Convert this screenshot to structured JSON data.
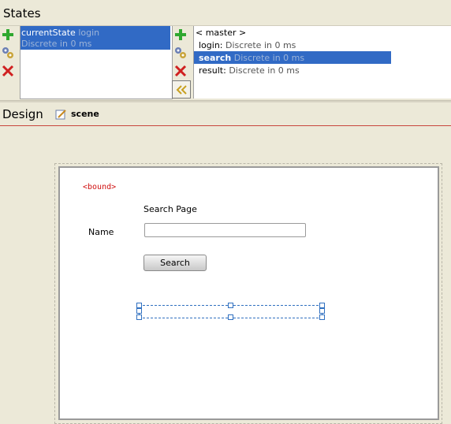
{
  "states_panel": {
    "title": "States",
    "left_list": {
      "selected_name": "currentState",
      "selected_value": "login",
      "selected_detail": "Discrete in 0 ms"
    },
    "right_list": {
      "master_label": "< master >",
      "items": [
        {
          "name": "login:",
          "detail": "Discrete in 0 ms"
        },
        {
          "name": "search",
          "detail": "Discrete in 0 ms",
          "selected": true
        },
        {
          "name": "result:",
          "detail": "Discrete in 0 ms"
        }
      ]
    }
  },
  "design_panel": {
    "title": "Design",
    "scene_label": "scene"
  },
  "canvas": {
    "bound_label": "<bound>",
    "search_page_text": "Search Page",
    "name_label": "Name",
    "name_input_value": "",
    "search_button_label": "Search"
  },
  "colors": {
    "selection": "#316ac5",
    "bound_text": "#d01010",
    "accent_line": "#c8463c"
  }
}
